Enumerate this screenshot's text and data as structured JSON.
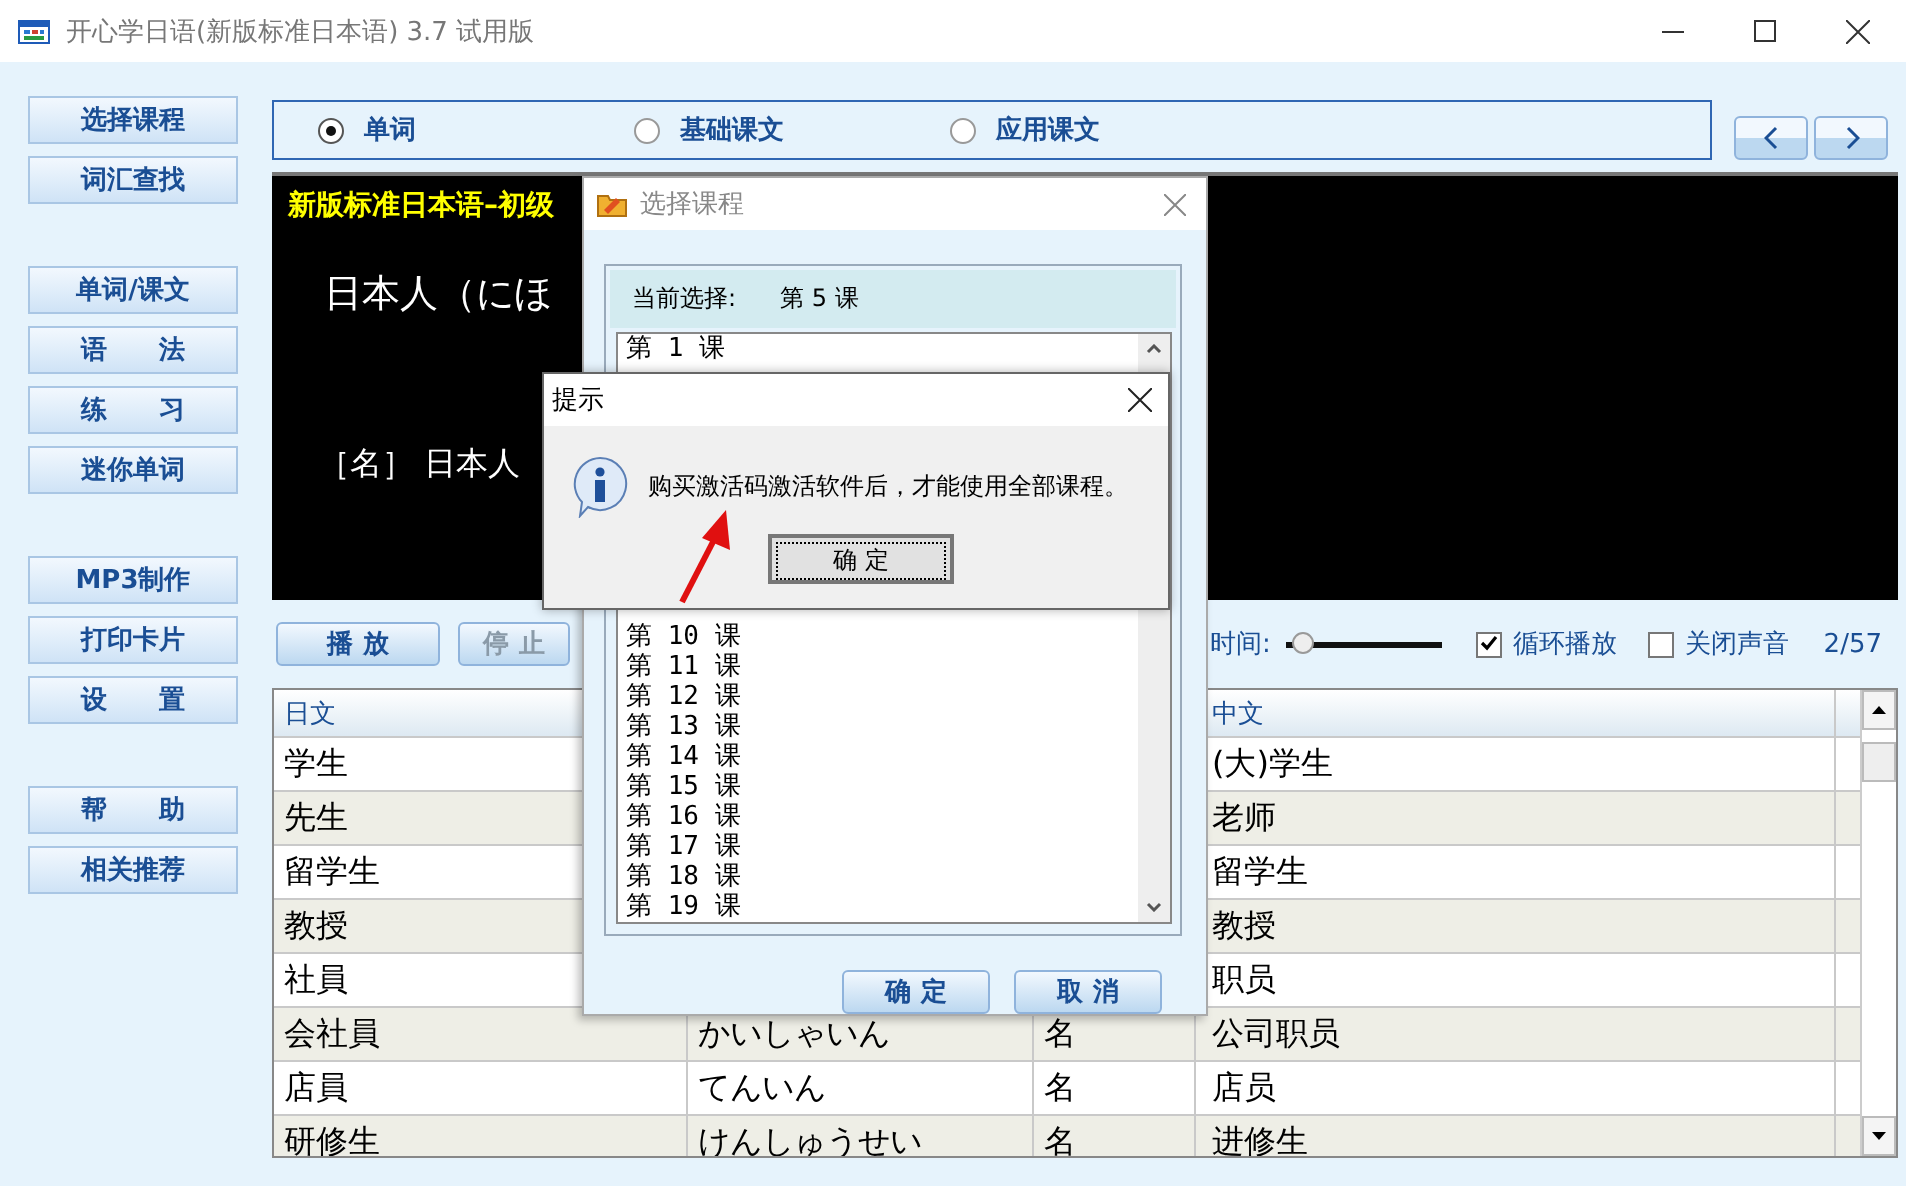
{
  "window": {
    "title": "开心学日语(新版标准日本语) 3.7 试用版"
  },
  "sidebar": {
    "groups": [
      [
        "选择课程",
        "词汇查找"
      ],
      [
        "单词/课文",
        "语　　法",
        "练　　习",
        "迷你单词"
      ],
      [
        "MP3制作",
        "打印卡片",
        "设　　置"
      ],
      [
        "帮　　助",
        "相关推荐"
      ]
    ]
  },
  "modes": [
    {
      "label": "单词",
      "selected": true
    },
    {
      "label": "基础课文",
      "selected": false
    },
    {
      "label": "应用课文",
      "selected": false
    }
  ],
  "display": {
    "title": "新版标准日本语–初级",
    "line1": "日本人（にほ",
    "line2": "［名］ 日本人"
  },
  "controls": {
    "play": {
      "label": "播 放",
      "disabled": false
    },
    "stop": {
      "label": "停 止",
      "disabled": true
    },
    "time_label": "时间:",
    "time_slider": {
      "level": 0.05
    },
    "loop": {
      "label": "循环播放",
      "checked": true
    },
    "mute": {
      "label": "关闭声音",
      "checked": false
    },
    "counter": "2/57"
  },
  "table": {
    "columns": [
      "日文",
      "中文"
    ],
    "rows": [
      {
        "jp": "学生",
        "cn": "(大)学生"
      },
      {
        "jp": "先生",
        "cn": "老师"
      },
      {
        "jp": "留学生",
        "cn": "留学生"
      },
      {
        "jp": "教授",
        "cn": "教授"
      },
      {
        "jp": "社員",
        "cn": "职员"
      },
      {
        "jp": "会社員",
        "reading": "かいしゃいん",
        "pos": "名",
        "cn": "公司职员"
      },
      {
        "jp": "店員",
        "reading": "てんいん",
        "pos": "名",
        "cn": "店员"
      },
      {
        "jp": "研修生",
        "reading": "けんしゅうせい",
        "pos": "名",
        "cn": "进修生"
      }
    ]
  },
  "course_dialog": {
    "title": "选择课程",
    "current_label": "当前选择:",
    "current_value": "第 5 课",
    "lessons": [
      "第 1 课",
      "第 10 课",
      "第 11 课",
      "第 12 课",
      "第 13 课",
      "第 14 课",
      "第 15 课",
      "第 16 课",
      "第 17 课",
      "第 18 课",
      "第 19 课"
    ],
    "ok": "确 定",
    "cancel": "取 消"
  },
  "prompt_dialog": {
    "title": "提示",
    "message": "购买激活码激活软件后，才能使用全部课程。",
    "ok": "确 定"
  }
}
